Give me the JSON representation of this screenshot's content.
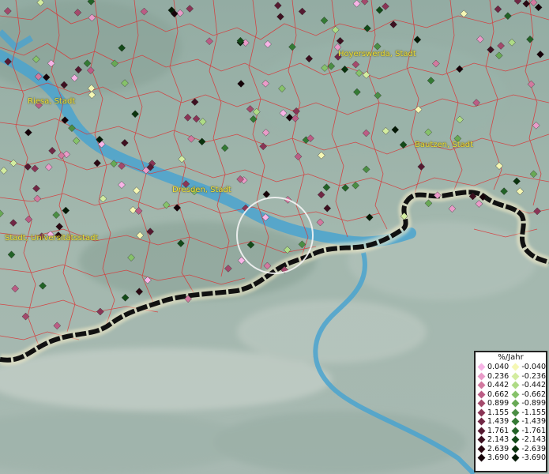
{
  "map": {
    "cities": [
      {
        "name": "Hoyerswerda, Stadt"
      },
      {
        "name": "Riesa, Stadt"
      },
      {
        "name": "Bautzen, Stadt"
      },
      {
        "name": "Dresden, Stadt"
      },
      {
        "name": "Stadt, Universitätsstadt"
      }
    ]
  },
  "legend": {
    "title": "%/Jahr",
    "positive": [
      {
        "value": "0.040",
        "color": "#f7b4e6"
      },
      {
        "value": "0.236",
        "color": "#e99bc8"
      },
      {
        "value": "0.442",
        "color": "#d2799f"
      },
      {
        "value": "0.662",
        "color": "#bb5d85"
      },
      {
        "value": "0.899",
        "color": "#a44a6c"
      },
      {
        "value": "1.155",
        "color": "#8a3556"
      },
      {
        "value": "1.439",
        "color": "#702744"
      },
      {
        "value": "1.761",
        "color": "#561a31"
      },
      {
        "value": "2.143",
        "color": "#3e1020"
      },
      {
        "value": "2.639",
        "color": "#2a0812"
      },
      {
        "value": "3.690",
        "color": "#150208"
      }
    ],
    "negative": [
      {
        "value": "-0.040",
        "color": "#f5f7b4"
      },
      {
        "value": "-0.236",
        "color": "#d3eca0"
      },
      {
        "value": "-0.442",
        "color": "#aedb86"
      },
      {
        "value": "-0.662",
        "color": "#86c26a"
      },
      {
        "value": "-0.899",
        "color": "#68a955"
      },
      {
        "value": "-1.155",
        "color": "#4b8e44"
      },
      {
        "value": "-1.439",
        "color": "#347a34"
      },
      {
        "value": "-1.761",
        "color": "#226226"
      },
      {
        "value": "-2.143",
        "color": "#134a18"
      },
      {
        "value": "-2.639",
        "color": "#0a330d"
      },
      {
        "value": "-3.690",
        "color": "#031a05"
      }
    ]
  }
}
